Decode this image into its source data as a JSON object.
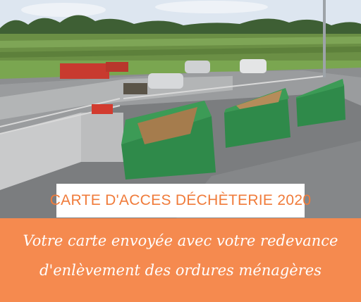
{
  "banner": {
    "title": "CARTE D'ACCES DÉCHÈTERIE 2020",
    "subtitle_line1": "Votre carte envoyée avec votre redevance",
    "subtitle_line2": "d'enlèvement des ordures ménagères"
  },
  "colors": {
    "accent": "#f58a4f",
    "title_text": "#f07b3a",
    "container_green": "#2f8a4a"
  }
}
